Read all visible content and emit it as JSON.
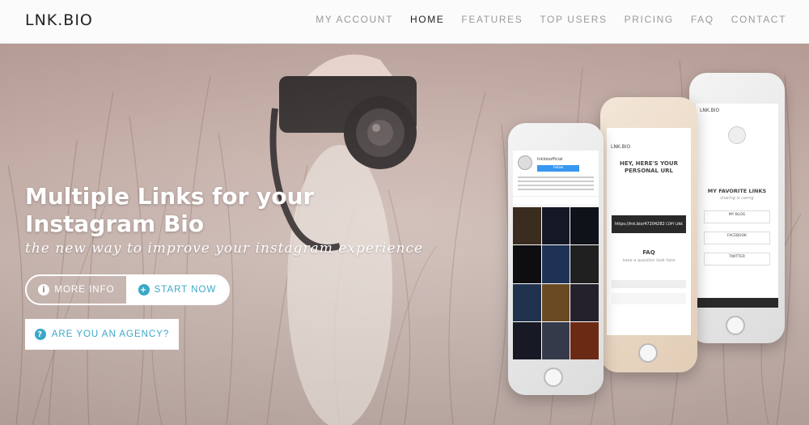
{
  "header": {
    "logo": "LNK.BIO",
    "nav": [
      "MY ACCOUNT",
      "HOME",
      "FEATURES",
      "TOP USERS",
      "PRICING",
      "FAQ",
      "CONTACT"
    ]
  },
  "hero": {
    "headline_line1": "Multiple Links for your",
    "headline_line2": "Instagram Bio",
    "tagline": "the new way to improve your instagram experience",
    "more_info": "MORE INFO",
    "start_now": "START NOW",
    "agency": "ARE YOU AN AGENCY?"
  },
  "phone_left": {
    "username": "lnkbioofficial",
    "follow": "Follow"
  },
  "phone_middle": {
    "logo": "LNK.BIO",
    "heading": "HEY, HERE'S YOUR PERSONAL URL",
    "url": "https://lnk.bio/47204282",
    "copy": "COPY LINK",
    "faq": "FAQ",
    "faq_sub": "have a question look here"
  },
  "phone_right": {
    "logo": "LNK.BIO",
    "heading": "MY FAVORITE LINKS",
    "sub": "sharing is caring",
    "links": [
      "MY BLOG",
      "FACEBOOK",
      "TWITTER"
    ]
  },
  "colors": {
    "accent": "#39a8c7"
  }
}
